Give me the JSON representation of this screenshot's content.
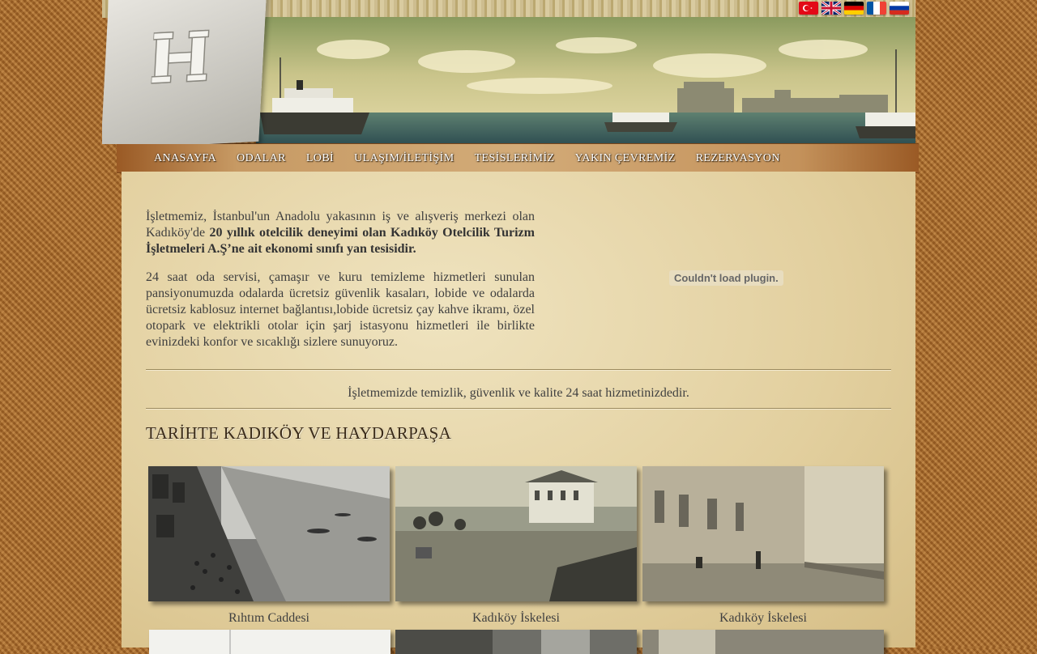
{
  "header": {
    "logo_alt": "H",
    "flags": [
      {
        "name": "turkish-flag-icon",
        "label": "Türkçe"
      },
      {
        "name": "uk-flag-icon",
        "label": "English"
      },
      {
        "name": "german-flag-icon",
        "label": "Deutsch"
      },
      {
        "name": "french-flag-icon",
        "label": "Français"
      },
      {
        "name": "russian-flag-icon",
        "label": "Русский"
      }
    ]
  },
  "nav": {
    "items": [
      "ANASAYFA",
      "ODALAR",
      "LOBİ",
      "ULAŞIM/İLETİŞİM",
      "TESİSLERİMİZ",
      "YAKIN ÇEVREMİZ",
      "REZERVASYON"
    ]
  },
  "intro": {
    "p1_a": "İşletmemiz, İstanbul'un Anadolu yakasının iş ve alışveriş merkezi olan Kadıköy'de ",
    "p1_b": "20 yıllık otelcilik deneyimi olan Kadıköy Otelcilik Turizm İşletmeleri A.Ş’ne ait ekonomi sınıfı yan tesisidir.",
    "p2": "24 saat oda servisi, çamaşır ve kuru temizleme hizmetleri sunulan pansiyonumuzda odalarda ücretsiz güvenlik kasaları, lobide ve odalarda ücretsiz kablosuz internet bağlantısı,lobide ücretsiz çay kahve ikramı, özel otopark ve elektrikli otolar için şarj istasyonu hizmetleri ile birlikte evinizdeki konfor ve sıcaklığı sizlere sunuyoruz."
  },
  "plugin": {
    "message": "Couldn't load plugin."
  },
  "tagline": "İşletmemizde temizlik, güvenlik ve kalite 24 saat hizmetinizdedir.",
  "history": {
    "title": "TARİHTE KADIKÖY VE HAYDARPAŞA",
    "photos": [
      {
        "caption": "Rıhtım Caddesi"
      },
      {
        "caption": "Kadıköy İskelesi"
      },
      {
        "caption": "Kadıköy İskelesi"
      }
    ]
  }
}
